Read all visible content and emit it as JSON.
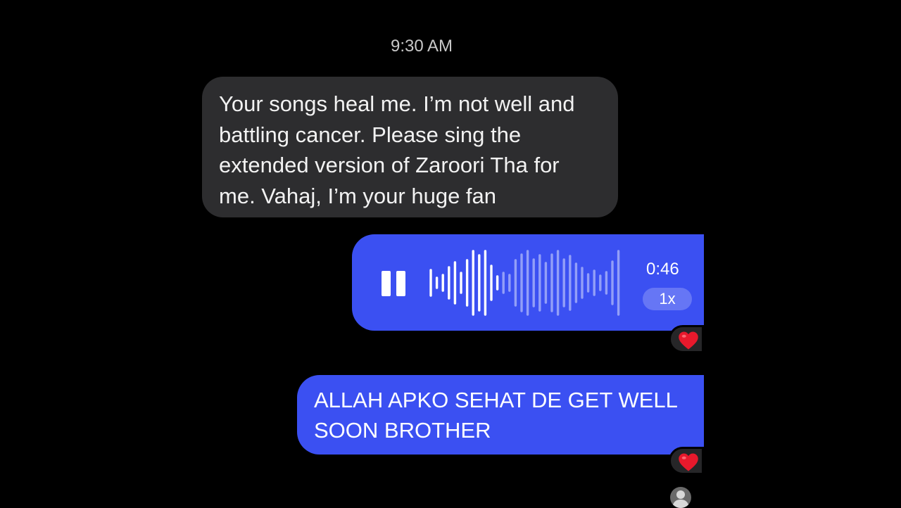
{
  "chat": {
    "timestamp": "9:30 AM",
    "incoming_message": "Your songs heal me. I’m not well and\nbattling cancer. Please sing the\nextended version of Zaroori Tha for\nme. Vahaj, I’m your huge fan",
    "voice_message": {
      "duration": "0:46",
      "playback_speed": "1x",
      "state": "playing",
      "progress": 0.35
    },
    "outgoing_message": "ALLAH APKO SEHAT DE GET WELL\nSOON BROTHER",
    "reactions": [
      "heart-icon",
      "heart-icon"
    ]
  },
  "colors": {
    "background": "#000000",
    "incoming_bubble": "#2d2d2f",
    "outgoing_bubble": "#3b50f2",
    "heart": "#e8192c"
  }
}
